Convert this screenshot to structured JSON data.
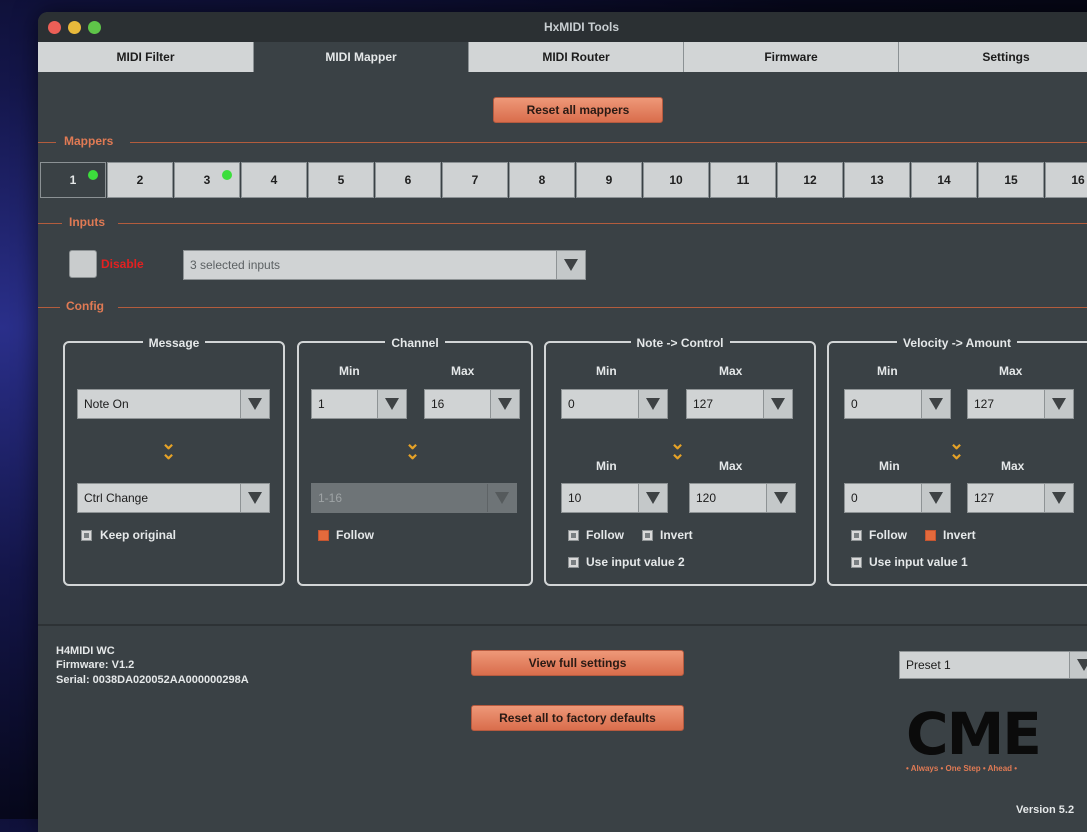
{
  "window": {
    "title": "HxMIDI Tools"
  },
  "tabs": [
    {
      "label": "MIDI Filter"
    },
    {
      "label": "MIDI Mapper"
    },
    {
      "label": "MIDI Router"
    },
    {
      "label": "Firmware"
    },
    {
      "label": "Settings"
    }
  ],
  "reset_mappers_label": "Reset all mappers",
  "sections": {
    "mappers": "Mappers",
    "inputs": "Inputs",
    "config": "Config"
  },
  "mappers": [
    "1",
    "2",
    "3",
    "4",
    "5",
    "6",
    "7",
    "8",
    "9",
    "10",
    "11",
    "12",
    "13",
    "14",
    "15",
    "16"
  ],
  "inputs": {
    "disable_label": "Disable",
    "selected": "3 selected inputs"
  },
  "message": {
    "title": "Message",
    "from": "Note On",
    "to": "Ctrl Change",
    "keep_original_label": "Keep original"
  },
  "channel": {
    "title": "Channel",
    "min_label": "Min",
    "max_label": "Max",
    "min": "1",
    "max": "16",
    "range": "1-16",
    "follow_label": "Follow"
  },
  "note_control": {
    "title": "Note -> Control",
    "min_label": "Min",
    "max_label": "Max",
    "in_min": "0",
    "in_max": "127",
    "out_min": "10",
    "out_max": "120",
    "follow_label": "Follow",
    "invert_label": "Invert",
    "use_input_label": "Use input value 2"
  },
  "velocity_amount": {
    "title": "Velocity -> Amount",
    "min_label": "Min",
    "max_label": "Max",
    "in_min": "0",
    "in_max": "127",
    "out_min": "0",
    "out_max": "127",
    "follow_label": "Follow",
    "invert_label": "Invert",
    "use_input_label": "Use input value 1"
  },
  "device": {
    "name": "H4MIDI WC",
    "firmware": "Firmware: V1.2",
    "serial": "Serial: 0038DA020052AA000000298A"
  },
  "view_full_settings_label": "View full settings",
  "factory_reset_label": "Reset all to factory defaults",
  "preset": "Preset 1",
  "logo_text": "CME",
  "tagline": "• Always • One Step • Ahead •",
  "version": "Version 5.2"
}
